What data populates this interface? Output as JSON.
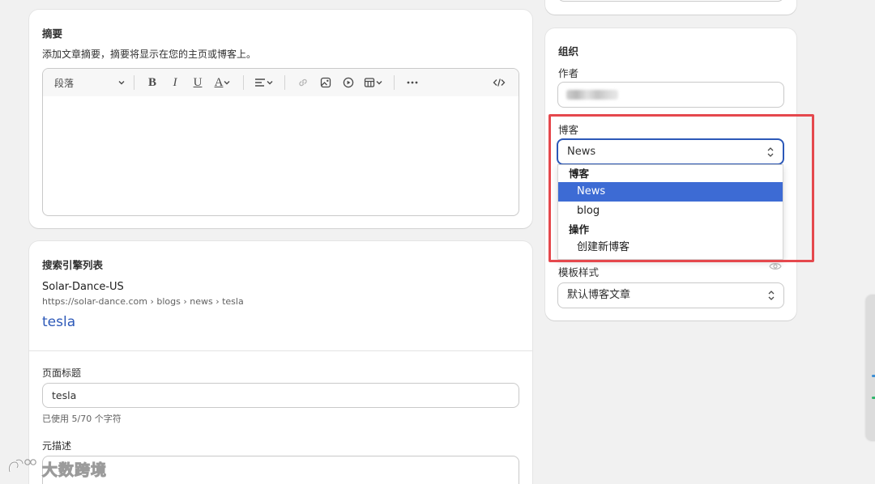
{
  "excerpt": {
    "title": "摘要",
    "description": "添加文章摘要，摘要将显示在您的主页或博客上。",
    "toolbar": {
      "format_value": "段落",
      "bold": "B",
      "italic": "I",
      "underline": "U",
      "text_color": "A"
    }
  },
  "seo": {
    "title": "搜索引擎列表",
    "store_name": "Solar-Dance-US",
    "url": "https://solar-dance.com › blogs › news › tesla",
    "link_title": "tesla",
    "page_title_label": "页面标题",
    "page_title_value": "tesla",
    "page_title_hint": "已使用 5/70 个字符",
    "meta_label": "元描述"
  },
  "organization": {
    "title": "组织",
    "author_label": "作者",
    "blog_label": "博客",
    "blog_value": "News",
    "template_label": "模板样式",
    "template_value": "默认博客文章"
  },
  "dropdown": {
    "group_blog": "博客",
    "items": [
      "News",
      "blog"
    ],
    "selected": "News",
    "group_actions": "操作",
    "create_new": "创建新博客"
  },
  "watermark": {
    "text": "大数跨境"
  },
  "colors": {
    "accent": "#2c58b8",
    "selection": "#3d6bd4",
    "highlight": "#e5484d",
    "background": "#f1f1f1"
  }
}
